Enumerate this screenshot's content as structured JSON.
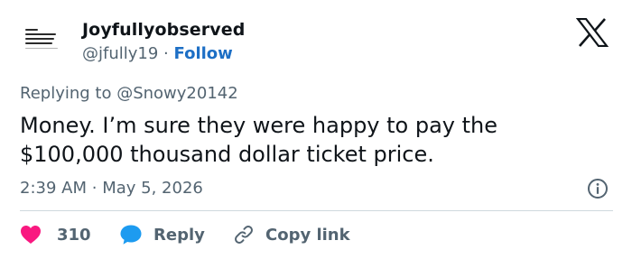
{
  "author": {
    "name": "Joyfullyobserved",
    "handle": "@jfully19",
    "separator": "·",
    "follow_label": "Follow"
  },
  "reply_context": {
    "label": "Replying to @Snowy20142"
  },
  "tweet": {
    "text": "Money. I’m sure they were happy to pay the $100,000 thousand dollar ticket price.",
    "time": "2:39 AM",
    "separator": "·",
    "date": "May 5, 2026"
  },
  "actions": {
    "like_count": "310",
    "reply_label": "Reply",
    "copy_label": "Copy link"
  },
  "colors": {
    "like": "#f91880",
    "reply": "#1d9bf0",
    "follow": "#1d6fc5",
    "secondary_text": "#536471"
  },
  "icons": {
    "logo": "x-logo-icon",
    "info": "info-icon",
    "like": "heart-icon",
    "reply": "speech-bubble-icon",
    "copy": "link-icon"
  }
}
